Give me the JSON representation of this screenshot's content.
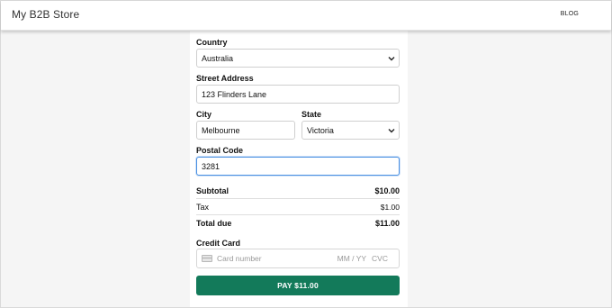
{
  "header": {
    "brand": "My B2B Store",
    "nav_blog": "BLOG"
  },
  "form": {
    "country": {
      "label": "Country",
      "value": "Australia"
    },
    "street": {
      "label": "Street Address",
      "value": "123 Flinders Lane"
    },
    "city": {
      "label": "City",
      "value": "Melbourne"
    },
    "state": {
      "label": "State",
      "value": "Victoria"
    },
    "postal": {
      "label": "Postal Code",
      "value": "3281"
    }
  },
  "summary": {
    "subtotal_label": "Subtotal",
    "subtotal_value": "$10.00",
    "tax_label": "Tax",
    "tax_value": "$1.00",
    "total_label": "Total due",
    "total_value": "$11.00"
  },
  "payment": {
    "label": "Credit Card",
    "card_placeholder": "Card number",
    "expiry_placeholder": "MM / YY",
    "cvc_placeholder": "CVC",
    "pay_button": "PAY $11.00"
  },
  "colors": {
    "pay_button_bg": "#137a5a",
    "focus_border": "#4a90e2"
  },
  "icons": {
    "select_arrow": "chevron-down-icon",
    "card": "credit-card-icon"
  }
}
